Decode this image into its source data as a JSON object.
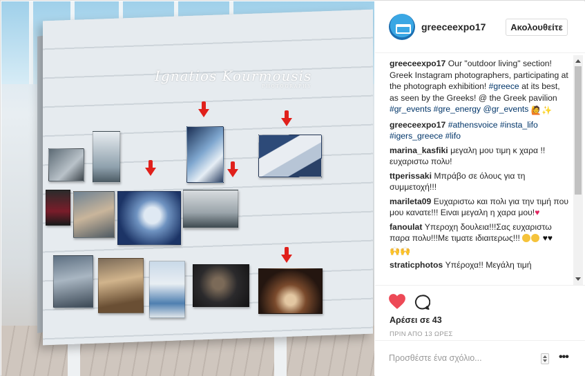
{
  "post": {
    "username": "greeceexpo17",
    "follow_label": "Ακολουθείτε",
    "likes": "Αρέσει σε 43",
    "time": "ΠΡΙΝ ΑΠΟ 13 ΩΡΕΣ",
    "add_comment_placeholder": "Προσθέστε ένα σχόλιο...",
    "more_label": "•••",
    "photo_signature": "Ignatios Kourmousis",
    "photo_signature_sub": "PHOTOGRAPHY"
  },
  "caption": {
    "author": "greeceexpo17",
    "text_1": "Our \"outdoor living\" section! Greek Instagram photographers, participating at the photograph exhibition!",
    "tag_greece": "#greece",
    "text_2": "at its best, as seen by the Greeks! @ the Greek pavilion",
    "tags": "#gr_events #gre_energy @gr_events"
  },
  "comments": [
    {
      "author": "greeceexpo17",
      "text": "#athensvoice #insta_lifo #igers_greece #lifo",
      "is_tags": true
    },
    {
      "author": "marina_kasfiki",
      "text": "μεγαλη μου τιμη κ χαρα !! ευχαριστω πολυ!"
    },
    {
      "author": "ttperissaki",
      "text": "Μπράβο σε όλους για τη συμμετοχή!!!"
    },
    {
      "author": "marileta09",
      "text": "Ευχαριστω και πολι για την τιμή που μου κανατε!!! Ειναι μεγαλη η χαρα μου!"
    },
    {
      "author": "fanoulat",
      "text": "Υπεροχη δουλεια!!!Σας ευχαριστω παρα πολυ!!!Με τιματε ιδιαιτερως!!!"
    },
    {
      "author": "straticphotos",
      "text": "Υπέροχα!! Μεγάλη τιμή"
    }
  ],
  "colors": {
    "link": "#003569",
    "like_red": "#ed4956",
    "arrow_red": "#e0201b"
  },
  "icons": [
    "heart-icon",
    "comment-icon",
    "more-icon",
    "avatar-logo-icon"
  ]
}
